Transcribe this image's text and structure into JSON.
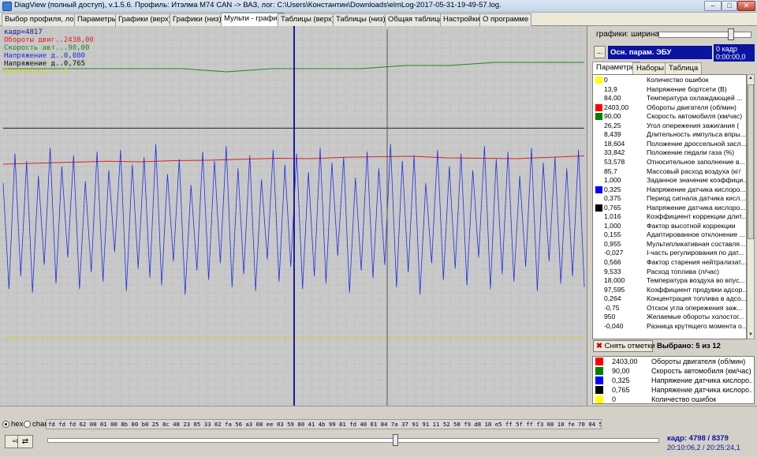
{
  "window": {
    "title": "DiagView (полный доступ), v.1.5.6. Профиль: Итэлма M74 CAN -> ВАЗ,  лог: C:\\Users\\Константин\\Downloads\\elmLog-2017-05-31-19-49-57.log.",
    "min": "–",
    "max": "□",
    "close": "✕"
  },
  "tabs": [
    "Выбор профиля, лога",
    "Параметры",
    "Графики (верх)",
    "Графики (низ)",
    "Мульти - график",
    "Таблицы (верх)",
    "Таблицы (низ)",
    "Общая таблица",
    "Настройки",
    "О программе"
  ],
  "active_tab": 4,
  "chart_legend": [
    {
      "text": "кадр=4817",
      "color": "#1a1a8a"
    },
    {
      "text": "Обороты двиг..2438,00",
      "color": "#e02020"
    },
    {
      "text": "Скорость авт...90,00",
      "color": "#1a8a1a"
    },
    {
      "text": "Напряжение д..0,080",
      "color": "#2030e0"
    },
    {
      "text": "Напряжение д..0,765",
      "color": "#101010"
    },
    {
      "text": "Количество о..0",
      "color": "#d8d020"
    }
  ],
  "chart_data": {
    "type": "line",
    "series": [
      {
        "color": "#1e8a1e",
        "values": [
          90,
          90,
          90,
          90,
          90,
          89,
          90,
          90,
          90,
          91,
          91,
          92,
          92,
          92
        ]
      },
      {
        "color": "#222222",
        "values": [
          0.765,
          0.765,
          0.765,
          0.765,
          0.765,
          0.765,
          0.765,
          0.765,
          0.765,
          0.765,
          0.765,
          0.765
        ]
      },
      {
        "color": "#e02020",
        "values": [
          2400,
          2405,
          2410,
          2415,
          2412,
          2418,
          2420,
          2425,
          2430,
          2428,
          2435,
          2438,
          2440,
          2432,
          2430,
          2428,
          2435,
          2442
        ]
      },
      {
        "color": "#2030e0",
        "values": [
          0.62,
          0.05,
          0.78,
          0.12,
          0.74,
          0.03,
          0.66,
          0.18,
          0.81,
          0.08,
          0.71,
          0.22,
          0.77,
          0.05,
          0.63,
          0.14,
          0.79,
          0.09,
          0.69,
          0.25,
          0.8,
          0.04,
          0.72,
          0.16,
          0.76,
          0.11,
          0.83,
          0.07,
          0.67,
          0.2,
          0.75,
          0.02,
          0.61,
          0.15,
          0.79,
          0.1,
          0.74,
          0.19,
          0.82,
          0.06,
          0.7,
          0.13,
          0.77,
          0.04,
          0.64,
          0.21,
          0.8,
          0.09,
          0.72,
          0.17,
          0.78,
          0.05,
          0.68,
          0.12,
          0.81,
          0.08,
          0.73,
          0.23,
          0.76,
          0.03,
          0.65,
          0.15,
          0.79,
          0.11,
          0.7,
          0.18,
          0.83,
          0.06,
          0.74,
          0.14,
          0.77,
          0.02,
          0.62,
          0.19,
          0.8,
          0.1,
          0.71,
          0.16,
          0.78,
          0.07,
          0.69,
          0.22,
          0.82,
          0.05,
          0.75,
          0.13,
          0.79,
          0.09,
          0.66,
          0.17,
          0.81,
          0.04,
          0.73,
          0.2,
          0.76,
          0.08,
          0.7,
          0.12,
          0.8,
          0.06
        ]
      },
      {
        "color": "#d8d020",
        "values": [
          0,
          0,
          0,
          0,
          0,
          0,
          0,
          0,
          0,
          0
        ]
      }
    ],
    "cursor_blue_frame": 4817,
    "cursor_grey_frame": 4798
  },
  "side": {
    "graphs_label": "графики:  ширина:",
    "dots_label": "...",
    "ecu_label": "Осн. парам. ЭБУ",
    "frame_box": [
      "0 кадр",
      "0:00:00,0"
    ],
    "subtabs": [
      "Параметры",
      "Наборы",
      "Таблица"
    ],
    "active_subtab": 0,
    "params": [
      {
        "color": "#ffff00",
        "value": "0",
        "name": "Количество ошибок"
      },
      {
        "color": "",
        "value": "13,9",
        "name": "Напряжение бортсети (В)"
      },
      {
        "color": "",
        "value": "84,00",
        "name": "Температура охлаждающей ..."
      },
      {
        "color": "#ff0000",
        "value": "2403,00",
        "name": "Обороты двигателя (об/мин)"
      },
      {
        "color": "#008000",
        "value": "90,00",
        "name": "Скорость автомобиля (км/час)"
      },
      {
        "color": "",
        "value": "26,25",
        "name": "Угол опережения зажигания ("
      },
      {
        "color": "",
        "value": "8,439",
        "name": "Длительность импульса впры..."
      },
      {
        "color": "",
        "value": "18,604",
        "name": "Положение дроссельной засл..."
      },
      {
        "color": "",
        "value": "33,842",
        "name": "Положение педали газа (%)"
      },
      {
        "color": "",
        "value": "53,578",
        "name": "Относительное заполнение в..."
      },
      {
        "color": "",
        "value": "85,7",
        "name": "Массовый расход воздуха (кг/"
      },
      {
        "color": "",
        "value": "1,000",
        "name": "Заданное значение коэффици..."
      },
      {
        "color": "#0000ff",
        "value": "0,325",
        "name": "Напряжение датчика кислоро..."
      },
      {
        "color": "",
        "value": "0,375",
        "name": "Период сигнала датчика кисл..."
      },
      {
        "color": "#000000",
        "value": "0,765",
        "name": "Напряжение датчика кислоро..."
      },
      {
        "color": "",
        "value": "1,016",
        "name": "Коэффициент коррекции длит..."
      },
      {
        "color": "",
        "value": "1,000",
        "name": "Фактор высотной коррекции"
      },
      {
        "color": "",
        "value": "0,155",
        "name": "Адаптированное отклонение ..."
      },
      {
        "color": "",
        "value": "0,955",
        "name": "Мультипликативная составля..."
      },
      {
        "color": "",
        "value": "-0,027",
        "name": "I-часть регулирования по дат..."
      },
      {
        "color": "",
        "value": "0,566",
        "name": "Фактор старения нейтрализат..."
      },
      {
        "color": "",
        "value": "9,533",
        "name": "Расход топлива (л/час)"
      },
      {
        "color": "",
        "value": "18,000",
        "name": "Температура воздуха во впус..."
      },
      {
        "color": "",
        "value": "97,595",
        "name": "Коэффициент продувки адсор..."
      },
      {
        "color": "",
        "value": "0,264",
        "name": "Концентрация топлива в адсо..."
      },
      {
        "color": "",
        "value": "-0,75",
        "name": "Отскок угла опережения заж..."
      },
      {
        "color": "",
        "value": "950",
        "name": "Желаемые обороты холостог..."
      },
      {
        "color": "",
        "value": "-0,040",
        "name": "Разница крутящего момента о..."
      }
    ],
    "clear_label": "Снять отметки",
    "clear_icon": "✖",
    "selected_label": "Выбрано: 5 из 12",
    "selected": [
      {
        "color": "#ff0000",
        "value": "2403,00",
        "name": "Обороты двигателя (об/мин)"
      },
      {
        "color": "#008000",
        "value": "90,00",
        "name": "Скорость автомобиля (км/час)"
      },
      {
        "color": "#0000ff",
        "value": "0,325",
        "name": "Напряжение датчика кислоро..."
      },
      {
        "color": "#000000",
        "value": "0,765",
        "name": "Напряжение датчика кислоро..."
      },
      {
        "color": "#ffff00",
        "value": "0",
        "name": "Количество ошибок"
      }
    ]
  },
  "bottom": {
    "hex_label": "hex",
    "char_label": "char",
    "hex_data": "fd fd fd 62 00 01 00 8b 00 b0 25 8c 48 23 05 33 02 fa 56 a3 08 ee 03 59 80 41 4b 99 81 fd 40 01 84 7a 37 91 91 11 52 58 f9 d8 10 e5 ff 5f ff f3 00 10 fe 70 04 51 98 64 23 01 fc 02 0f 64 c2 dc 09 00 12 99 2f 79 aa aa ...",
    "tool1": "⇨",
    "tool2": "⇄",
    "kadr": "кадр: 4798 / 8379",
    "time": "20:10:06,2 / 20:25:24,1"
  }
}
